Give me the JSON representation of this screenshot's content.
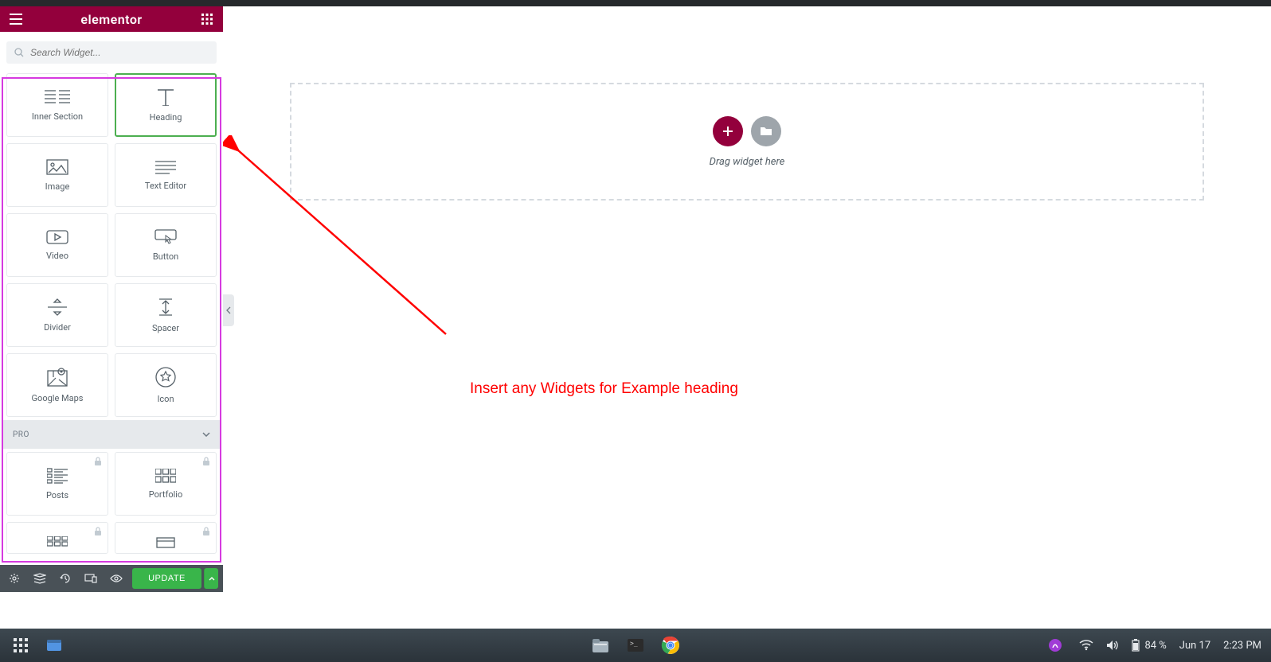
{
  "header": {
    "logo": "elementor"
  },
  "search": {
    "placeholder": "Search Widget..."
  },
  "widgets": {
    "basic": [
      {
        "label": "Inner Section"
      },
      {
        "label": "Heading"
      },
      {
        "label": "Image"
      },
      {
        "label": "Text Editor"
      },
      {
        "label": "Video"
      },
      {
        "label": "Button"
      },
      {
        "label": "Divider"
      },
      {
        "label": "Spacer"
      },
      {
        "label": "Google Maps"
      },
      {
        "label": "Icon"
      }
    ],
    "pro_section_label": "PRO",
    "pro": [
      {
        "label": "Posts"
      },
      {
        "label": "Portfolio"
      }
    ]
  },
  "footer": {
    "update_label": "UPDATE"
  },
  "canvas": {
    "drag_text": "Drag widget here"
  },
  "annotation": {
    "text": "Insert any Widgets for Example heading"
  },
  "taskbar": {
    "battery": "84 %",
    "date": "Jun 17",
    "time": "2:23 PM"
  }
}
